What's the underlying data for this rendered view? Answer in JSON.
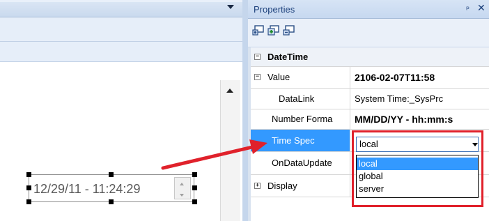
{
  "properties_panel": {
    "title": "Properties",
    "pin_icon": "pin-icon",
    "close_icon": "close-icon",
    "toolbar_icons": [
      "categorized-view-icon",
      "alphabetical-view-icon",
      "property-pages-icon"
    ],
    "category": "DateTime",
    "rows": [
      {
        "name": "Value",
        "value": "2106-02-07T11:58",
        "value_bold": true,
        "expander": "minus"
      },
      {
        "name": "DataLink",
        "value": "System Time:_SysPrc",
        "value_bold": false
      },
      {
        "name": "Number Forma",
        "value": "MM/DD/YY - hh:mm:s",
        "value_bold": true
      },
      {
        "name": "Time Spec",
        "value": "",
        "value_bold": false,
        "selected": true
      },
      {
        "name": "OnDataUpdate",
        "value": "",
        "value_bold": false
      },
      {
        "name": "Display",
        "value": "",
        "value_bold": false,
        "expander": "plus"
      }
    ]
  },
  "time_spec_dropdown": {
    "selected": "local",
    "options": [
      "local",
      "global",
      "server"
    ],
    "highlight_color": "#e0212b"
  },
  "designer": {
    "datetime_widget_text": "12/29/11 - 11:24:29"
  },
  "colors": {
    "selection_blue": "#3399ff",
    "annotation_red": "#e0212b",
    "header_blue": "#c6d8f0"
  }
}
